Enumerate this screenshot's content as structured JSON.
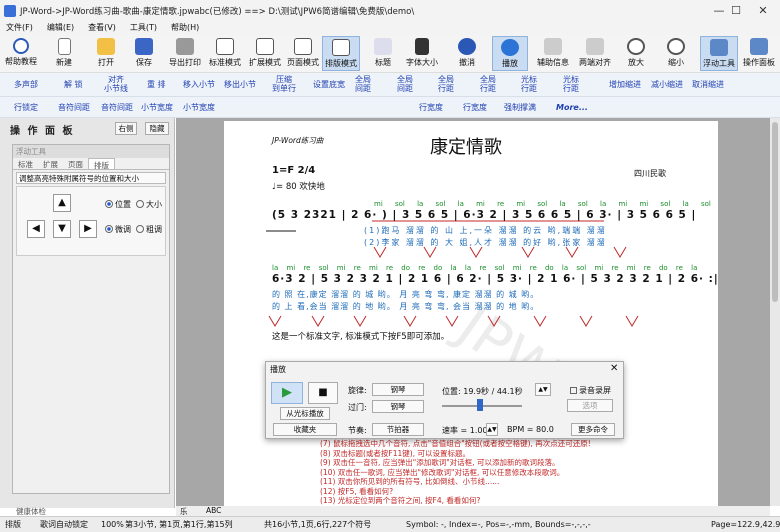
{
  "window": {
    "title": "JP-Word->JP-Word练习曲-歌曲-康定情歌.jpwabc(已修改) ==> D:\\测试\\JPW6简谱编辑\\免费版\\demo\\",
    "minimize": "—",
    "maximize": "☐",
    "close": "✕"
  },
  "menu": [
    "文件(F)",
    "编辑(E)",
    "查看(V)",
    "工具(T)",
    "帮助(H)"
  ],
  "toolbar": [
    {
      "label": "帮助教程",
      "icon": "help-icon"
    },
    {
      "label": "新建",
      "icon": "new-doc-icon"
    },
    {
      "label": "打开",
      "icon": "open-folder-icon"
    },
    {
      "label": "保存",
      "icon": "save-icon"
    },
    {
      "label": "导出打印",
      "icon": "print-icon"
    },
    {
      "label": "标准模式",
      "icon": "standard-mode-icon"
    },
    {
      "label": "扩展模式",
      "icon": "extend-mode-icon"
    },
    {
      "label": "页面模式",
      "icon": "page-mode-icon"
    },
    {
      "label": "排版模式",
      "icon": "layout-mode-icon"
    },
    {
      "label": "标题",
      "icon": "title-icon"
    },
    {
      "label": "字体大小",
      "icon": "font-size-icon"
    },
    {
      "label": "撤消",
      "icon": "undo-icon"
    },
    {
      "label": "播放",
      "icon": "play-icon"
    },
    {
      "label": "辅助信息",
      "icon": "assist-info-icon"
    },
    {
      "label": "两端对齐",
      "icon": "justify-icon"
    },
    {
      "label": "放大",
      "icon": "zoom-in-icon"
    },
    {
      "label": "缩小",
      "icon": "zoom-out-icon"
    },
    {
      "label": "浮动工具",
      "icon": "float-tools-icon"
    },
    {
      "label": "操作面板",
      "icon": "panel-icon"
    }
  ],
  "row2": [
    "多声部",
    "解 锁",
    "对齐\n小节线",
    "重 排",
    "移入小节",
    "移出小节",
    "压缩\n到单行",
    "设置底宽",
    "全局\n间距",
    "全局\n间距",
    "全局\n行距",
    "全局\n行距",
    "光标\n行距",
    "光标\n行距",
    "增加缩进",
    "减小缩进",
    "取消缩进"
  ],
  "row3": [
    "行锁定",
    "音符间距",
    "音符间距",
    "小节宽度",
    "小节宽度",
    "行宽度",
    "行宽度",
    "强制撑满",
    "More..."
  ],
  "left_panel": {
    "title": "操 作 面 板",
    "right_btn": "右侧",
    "hide_btn": "隐藏",
    "float_title": "浮动工具",
    "tabs": [
      "标准",
      "扩展",
      "页面",
      "排版"
    ],
    "section": "调整高亮特殊附属符号的位置和大小",
    "radios": [
      {
        "label": "位置",
        "checked": true
      },
      {
        "label": "大小",
        "checked": false
      },
      {
        "label": "微调",
        "checked": true
      },
      {
        "label": "粗调",
        "checked": false
      }
    ],
    "footer": "健康体检"
  },
  "score": {
    "header": "JP-Word练习曲",
    "title": "康定情歌",
    "key": "1=F 2/4",
    "tempo": "♩= 80  欢快地",
    "origin": "四川民歌",
    "row1": "(5 3 2321 | 2 6· ) | 3 5 6 5 | 6·3 2 | 3 5 6 6 5 | 6 3· | 3 5 6 6 5 |",
    "row1_solfa": [
      "mi sol la sol",
      "la mi re",
      "mi sol la sol",
      "la mi",
      "mi sol la sol"
    ],
    "lyric1": [
      "(1)跑马 溜溜 的 山",
      "上,一朵 溜溜",
      "的云",
      "哟,端端 溜溜"
    ],
    "lyric2": [
      "(2)李家 溜溜 的 大",
      "姐,人才 溜溜",
      "的好",
      "哟,张家 溜溜"
    ],
    "row2": "6·3 2 | 5 3 2 3 2 1 | 2 1 6 | 6 2· | 5 3· | 2 1 6· | 5 3 2 3 2 1 | 2 6· :|",
    "row2_solfa": [
      "la mi re",
      "sol mi re mi re do",
      "re do la",
      "la re",
      "sol mi",
      "re do la",
      "sol mi re mi re do",
      "re la"
    ],
    "lyric3": [
      "的 照",
      "在,康定 溜溜 的 城",
      "哟。 月",
      "亮",
      "弯",
      "弯,",
      "康定 溜溜 的 城",
      "哟。"
    ],
    "lyric4": [
      "的 上",
      "看,会当 溜溜 的",
      "地",
      "哟。 月",
      "亮",
      "弯",
      "弯,",
      "会当 溜溜 的 地",
      "哟。"
    ],
    "note": "这是一个标准文字, 标准模式下按F5即可添加。",
    "watermark": "JPW"
  },
  "dialog": {
    "title": "播放",
    "melody_label": "旋律:",
    "melody_value": "钢琴",
    "bridge_label": "过门:",
    "bridge_value": "钢琴",
    "position": "位置: 19.9秒 / 44.1秒",
    "record_label": "录音录屏",
    "options_btn": "选项",
    "from_cursor": "从光标播放",
    "collect": "收藏夹",
    "rhythm_label": "节奏:",
    "rhythm_value": "节拍器",
    "rate": "速率 = 1.00",
    "bpm": "BPM = 80.0",
    "more": "更多命令"
  },
  "tips": [
    "(7) 鼠标拖拽选中几个音符, 点击\"音值组合\"按钮(或者按空格键), 再次点还可还原!",
    "(8) 双击标题(或者按F11键), 可以设置标题。",
    "(9) 双击任一音符, 应当弹出\"添加歌词\"对话框, 可以添加新的歌词段落。",
    "(10) 双击任一歌词, 应当弹出\"修改歌词\"对话框, 可以任意修改本段歌词。",
    "(11) 双击你所见到的所有符号, 比如倒线、小节线......",
    "(12) 按F5, 看看如何?",
    "(13) 光标定位到两个音符之间, 按F4, 看看如何?"
  ],
  "bottom_tabs": [
    "乐谱",
    "ABC代码"
  ],
  "status": [
    "排版",
    "歌词自动锁定",
    "100%",
    "第3小节, 第1页,第1行,第15列",
    "共16小节,1页,6行,227个符号",
    "Symbol: -, Index=-, Pos=-,-mm, Bounds=-,-,-,-",
    "Page=122.9,42.9"
  ]
}
